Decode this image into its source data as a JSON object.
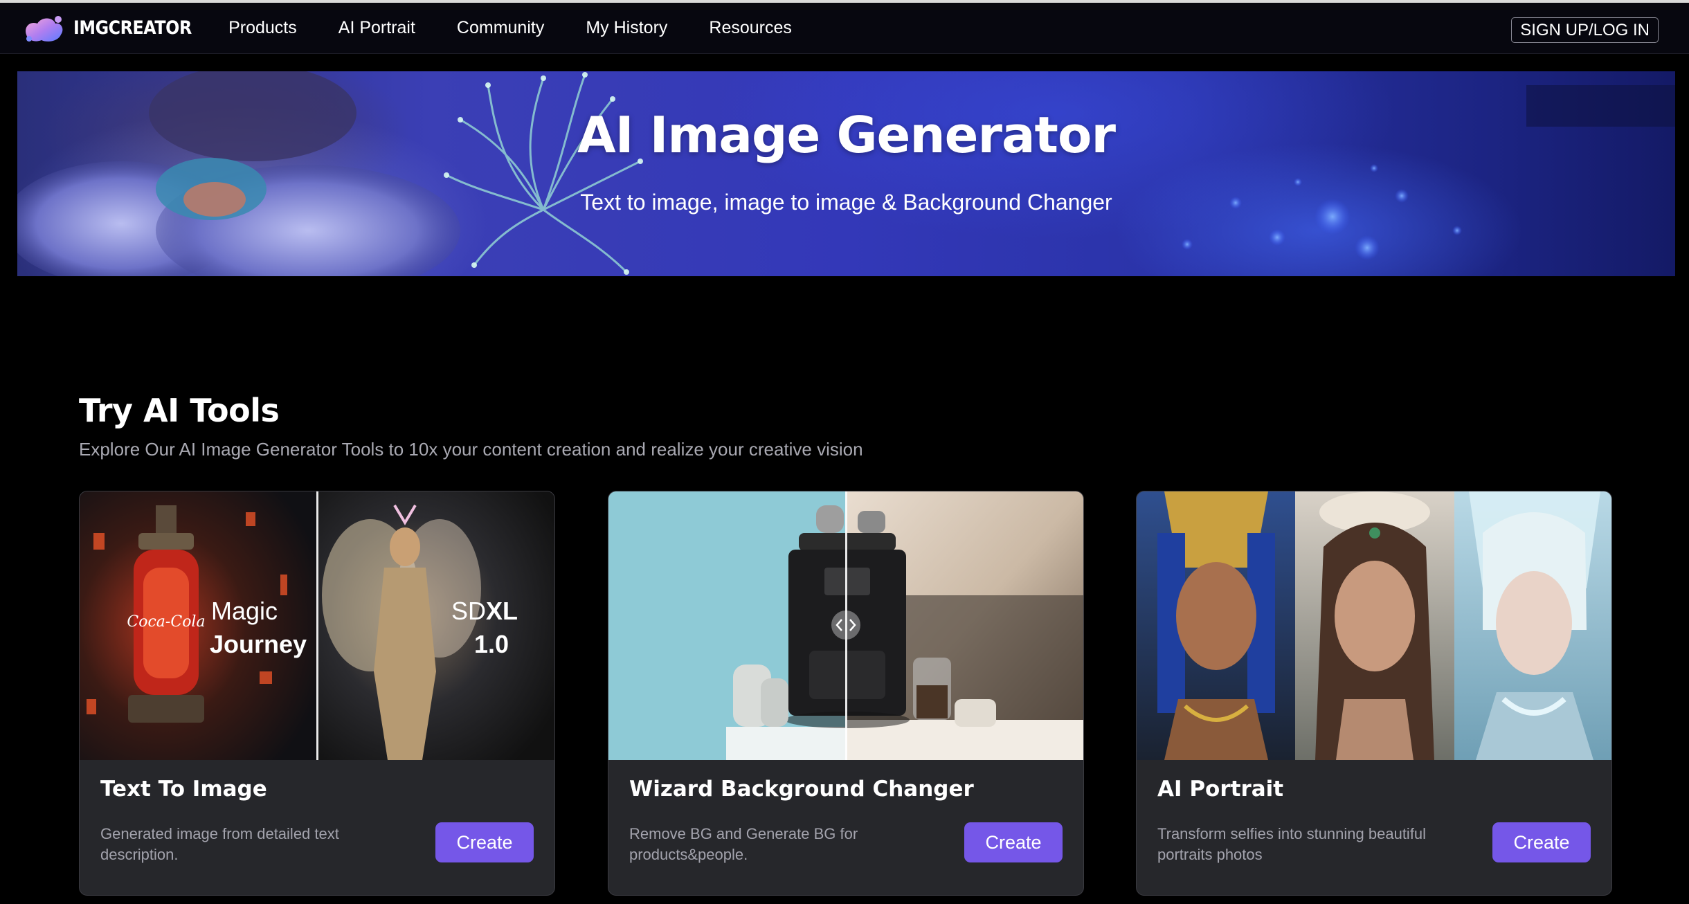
{
  "brand": {
    "name": "IMGCREATOR"
  },
  "nav": {
    "items": [
      {
        "label": "Products"
      },
      {
        "label": "AI Portrait"
      },
      {
        "label": "Community"
      },
      {
        "label": "My History"
      },
      {
        "label": "Resources"
      }
    ],
    "signup_label": "SIGN UP/LOG IN"
  },
  "hero": {
    "title": "AI Image Generator",
    "subtitle": "Text to image, image to image & Background Changer"
  },
  "section": {
    "title": "Try AI Tools",
    "description": "Explore Our AI Image Generator Tools to 10x your content creation and realize your creative vision"
  },
  "cards": [
    {
      "title": "Text To Image",
      "description": "Generated image from detailed text description.",
      "button": "Create",
      "image_text": {
        "left_line1": "Magic",
        "left_line2": "Journey",
        "right_line1_light": "SD",
        "right_line1_bold": "XL",
        "right_line2": "1.0",
        "bottle_label": "Coca-Cola"
      }
    },
    {
      "title": "Wizard Background Changer",
      "description": "Remove BG and Generate BG for products&people.",
      "button": "Create"
    },
    {
      "title": "AI Portrait",
      "description": "Transform selfies into stunning beautiful portraits photos",
      "button": "Create"
    }
  ],
  "colors": {
    "accent": "#7557e8",
    "background": "#000000",
    "card": "#26272b",
    "nav": "#07070f",
    "muted_text": "#a9a9b2"
  }
}
